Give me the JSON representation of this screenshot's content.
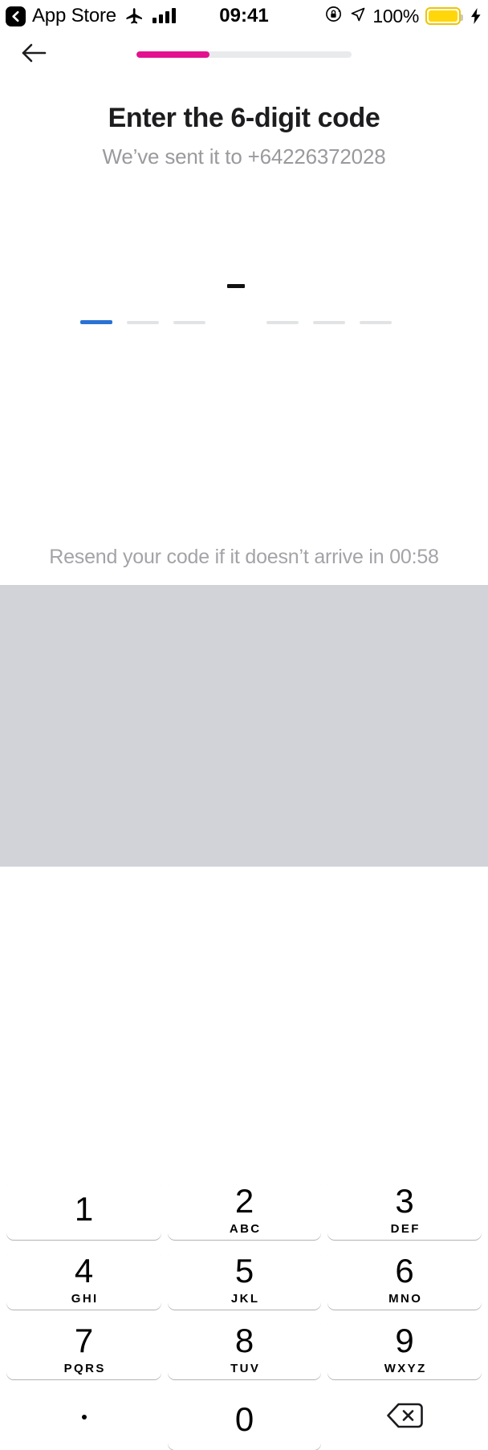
{
  "statusbar": {
    "back_app_label": "App Store",
    "back_icon": "chevron-left-icon",
    "airplane_icon": "airplane-mode-icon",
    "signal_icon": "cellular-signal-icon",
    "time": "09:41",
    "rotation_lock_icon": "rotation-lock-icon",
    "location_icon": "location-arrow-icon",
    "battery_percent": "100%",
    "battery_icon": "battery-full-icon",
    "charging_icon": "lightning-bolt-icon",
    "battery_color": "#ffd60a"
  },
  "nav": {
    "back_icon": "arrow-left-icon",
    "progress_percent": 34,
    "progress_fill_color": "#e3118f",
    "progress_track_color": "#e9eaec"
  },
  "content": {
    "title": "Enter the 6-digit code",
    "subtitle": "We’ve sent it to +64226372028",
    "separator": "–",
    "resend_text": "Resend your code if it doesn’t arrive in 00:58"
  },
  "otp": {
    "length": 6,
    "active_index": 0,
    "active_color": "#2a72d4",
    "inactive_color": "#e2e3e5",
    "values": [
      "",
      "",
      "",
      "",
      "",
      ""
    ],
    "slot_positions": [
      100,
      158,
      216,
      332,
      390,
      448
    ]
  },
  "keyboard": {
    "background_color": "#d1d3d9",
    "keys": [
      {
        "num": "1",
        "letters": "",
        "name": "key-1"
      },
      {
        "num": "2",
        "letters": "ABC",
        "name": "key-2"
      },
      {
        "num": "3",
        "letters": "DEF",
        "name": "key-3"
      },
      {
        "num": "4",
        "letters": "GHI",
        "name": "key-4"
      },
      {
        "num": "5",
        "letters": "JKL",
        "name": "key-5"
      },
      {
        "num": "6",
        "letters": "MNO",
        "name": "key-6"
      },
      {
        "num": "7",
        "letters": "PQRS",
        "name": "key-7"
      },
      {
        "num": "8",
        "letters": "TUV",
        "name": "key-8"
      },
      {
        "num": "9",
        "letters": "WXYZ",
        "name": "key-9"
      },
      {
        "num": "0",
        "letters": "",
        "name": "key-0"
      }
    ],
    "dot_key": ".",
    "delete_icon": "backspace-delete-icon"
  }
}
